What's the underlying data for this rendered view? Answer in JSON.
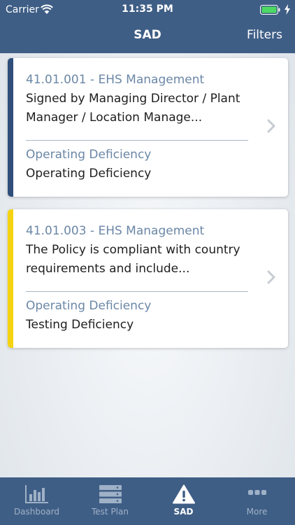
{
  "status_bar": {
    "carrier": "Carrier",
    "time": "11:35 PM"
  },
  "nav": {
    "title": "SAD",
    "filters_label": "Filters"
  },
  "colors": {
    "header": "#3f5e86",
    "stripe_blue": "#2f4f7a",
    "stripe_yellow": "#f5d312",
    "accent_text": "#6b87a6"
  },
  "cards": [
    {
      "code": "41.01.001 - EHS Management",
      "description": "Signed by Managing Director / Plant Manager / Location Manage...",
      "category_label": "Operating Deficiency",
      "category_value": "Operating Deficiency",
      "stripe_color": "#2f4f7a"
    },
    {
      "code": "41.01.003 - EHS Management",
      "description": "The Policy is compliant with country requirements and include...",
      "category_label": "Operating Deficiency",
      "category_value": "Testing Deficiency",
      "stripe_color": "#f5d312"
    }
  ],
  "tabs": [
    {
      "label": "Dashboard",
      "icon": "bar-chart-icon",
      "active": false
    },
    {
      "label": "Test Plan",
      "icon": "server-stack-icon",
      "active": false
    },
    {
      "label": "SAD",
      "icon": "warning-triangle-icon",
      "active": true
    },
    {
      "label": "More",
      "icon": "more-dots-icon",
      "active": false
    }
  ]
}
